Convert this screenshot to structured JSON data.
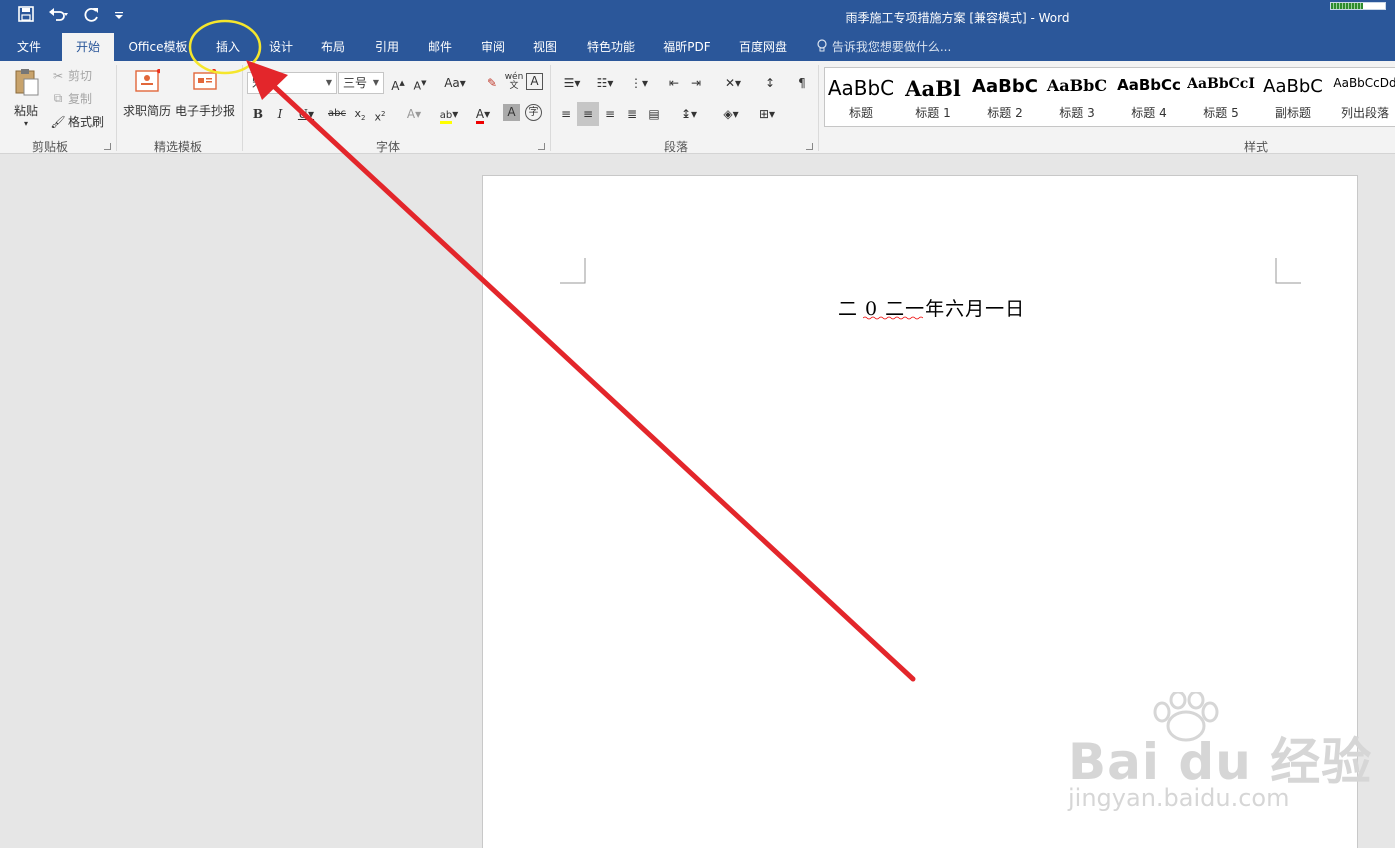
{
  "window": {
    "title": "雨季施工专项措施方案 [兼容模式] - Word"
  },
  "qat": {
    "save_icon": "save-icon",
    "undo_icon": "undo-icon",
    "redo_icon": "redo-icon",
    "customize_icon": "customize-qat-icon"
  },
  "tabs": [
    {
      "label": "文件"
    },
    {
      "label": "开始"
    },
    {
      "label": "Office模板"
    },
    {
      "label": "插入"
    },
    {
      "label": "设计"
    },
    {
      "label": "布局"
    },
    {
      "label": "引用"
    },
    {
      "label": "邮件"
    },
    {
      "label": "审阅"
    },
    {
      "label": "视图"
    },
    {
      "label": "特色功能"
    },
    {
      "label": "福昕PDF"
    },
    {
      "label": "百度网盘"
    }
  ],
  "tellme": "告诉我您想要做什么...",
  "clipboard": {
    "paste": "粘贴",
    "cut": "剪切",
    "copy": "复制",
    "format_painter": "格式刷",
    "group": "剪贴板"
  },
  "templates": {
    "resume": "求职简历",
    "handwritten": "电子手抄报",
    "group": "精选模板"
  },
  "font": {
    "name": "宋体",
    "size": "三号",
    "group": "字体"
  },
  "paragraph": {
    "group": "段落"
  },
  "styles": {
    "group": "样式",
    "items": [
      {
        "sample": "AaBbC",
        "name": "标题"
      },
      {
        "sample": "AaBl",
        "name": "标题 1"
      },
      {
        "sample": "AaBbC",
        "name": "标题 2"
      },
      {
        "sample": "AaBbC",
        "name": "标题 3"
      },
      {
        "sample": "AaBbCc",
        "name": "标题 4"
      },
      {
        "sample": "AaBbCcI",
        "name": "标题 5"
      },
      {
        "sample": "AaBbC",
        "name": "副标题"
      },
      {
        "sample": "AaBbCcDd",
        "name": "列出段落"
      }
    ]
  },
  "document": {
    "date_text": "二 0 二一年六月一日"
  },
  "annotation": {
    "highlight_color": "#f5e62c",
    "arrow_color": "#e3262b"
  },
  "watermark": {
    "main": "Bai du 经验",
    "sub": "jingyan.baidu.com"
  },
  "colors": {
    "brand": "#2b579a",
    "ribbon_bg": "#f3f3f3",
    "canvas_bg": "#e6e6e6"
  }
}
